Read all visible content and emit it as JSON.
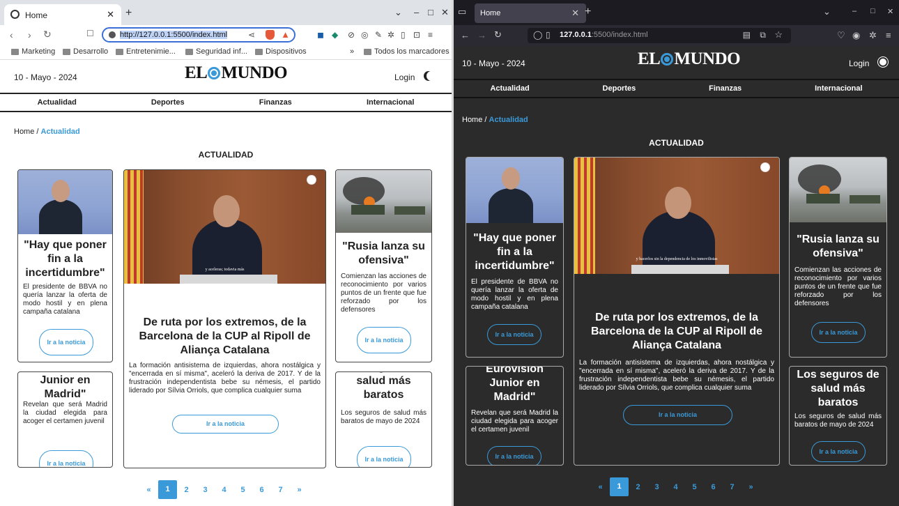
{
  "left_browser": {
    "tab_title": "Home",
    "url": "http://127.0.0.1:5500/index.html",
    "bookmarks": [
      "Marketing",
      "Desarrollo",
      "Entretenimie...",
      "Seguridad inf...",
      "Dispositivos"
    ],
    "bookmarks_more": "»",
    "all_bookmarks": "Todos los marcadores"
  },
  "right_browser": {
    "tab_title": "Home",
    "url_host": "127.0.0.1",
    "url_rest": ":5500/index.html"
  },
  "site": {
    "date": "10 - Mayo - 2024",
    "logo_left": "EL",
    "logo_right": "MUNDO",
    "login": "Login",
    "menu": [
      "Actualidad",
      "Deportes",
      "Finanzas",
      "Internacional"
    ],
    "breadcrumb_home": "Home",
    "breadcrumb_sep": "/",
    "breadcrumb_current": "Actualidad",
    "section_title": "ACTUALIDAD",
    "articles": [
      {
        "title": "\"Hay que poner fin a la incertidumbre\"",
        "text": "El presidente de BBVA no quería lanzar la oferta de modo hostil y en plena campaña catalana",
        "button": "Ir a la noticia"
      },
      {
        "title": "De ruta por los extremos, de la Barcelona de la CUP al Ripoll de Aliança Catalana",
        "text": "La formación antisistema de izquierdas, ahora nostálgica y \"encerrada en sí misma\", aceleró la deriva de 2017. Y de la frustración independentista bebe su némesis, el partido liderado por Sílvia Orriols, que complica cualquier suma",
        "button": "Ir a la noticia",
        "video_caption_left": "y aceleras; todavia más",
        "video_caption_right": "y hacerlos sin la dependencia de los inmovilistas"
      },
      {
        "title": "\"Rusia lanza su ofensiva\"",
        "text": "Comienzan las acciones de reconocimiento por varios puntos de un frente que fue reforzado por los defensores",
        "button": "Ir a la noticia"
      },
      {
        "title_left": "Junior en Madrid\"",
        "title_right": "Eurovision Junior en Madrid\"",
        "text": "Revelan que será Madrid la ciudad elegida para acoger el certamen juvenil",
        "button": "Ir a la noticia"
      },
      {
        "title_left": "Los seguros de salud más baratos",
        "title_right": "Los seguros de salud más baratos",
        "text": "Los seguros de salud más baratos de mayo de 2024",
        "button": "Ir a la noticia"
      }
    ],
    "pagination": [
      "«",
      "1",
      "2",
      "3",
      "4",
      "5",
      "6",
      "7",
      "»"
    ]
  },
  "colors": {
    "accent": "#3a9ad9",
    "dark_bg": "#2b2b2b",
    "border_dark": "#444"
  }
}
